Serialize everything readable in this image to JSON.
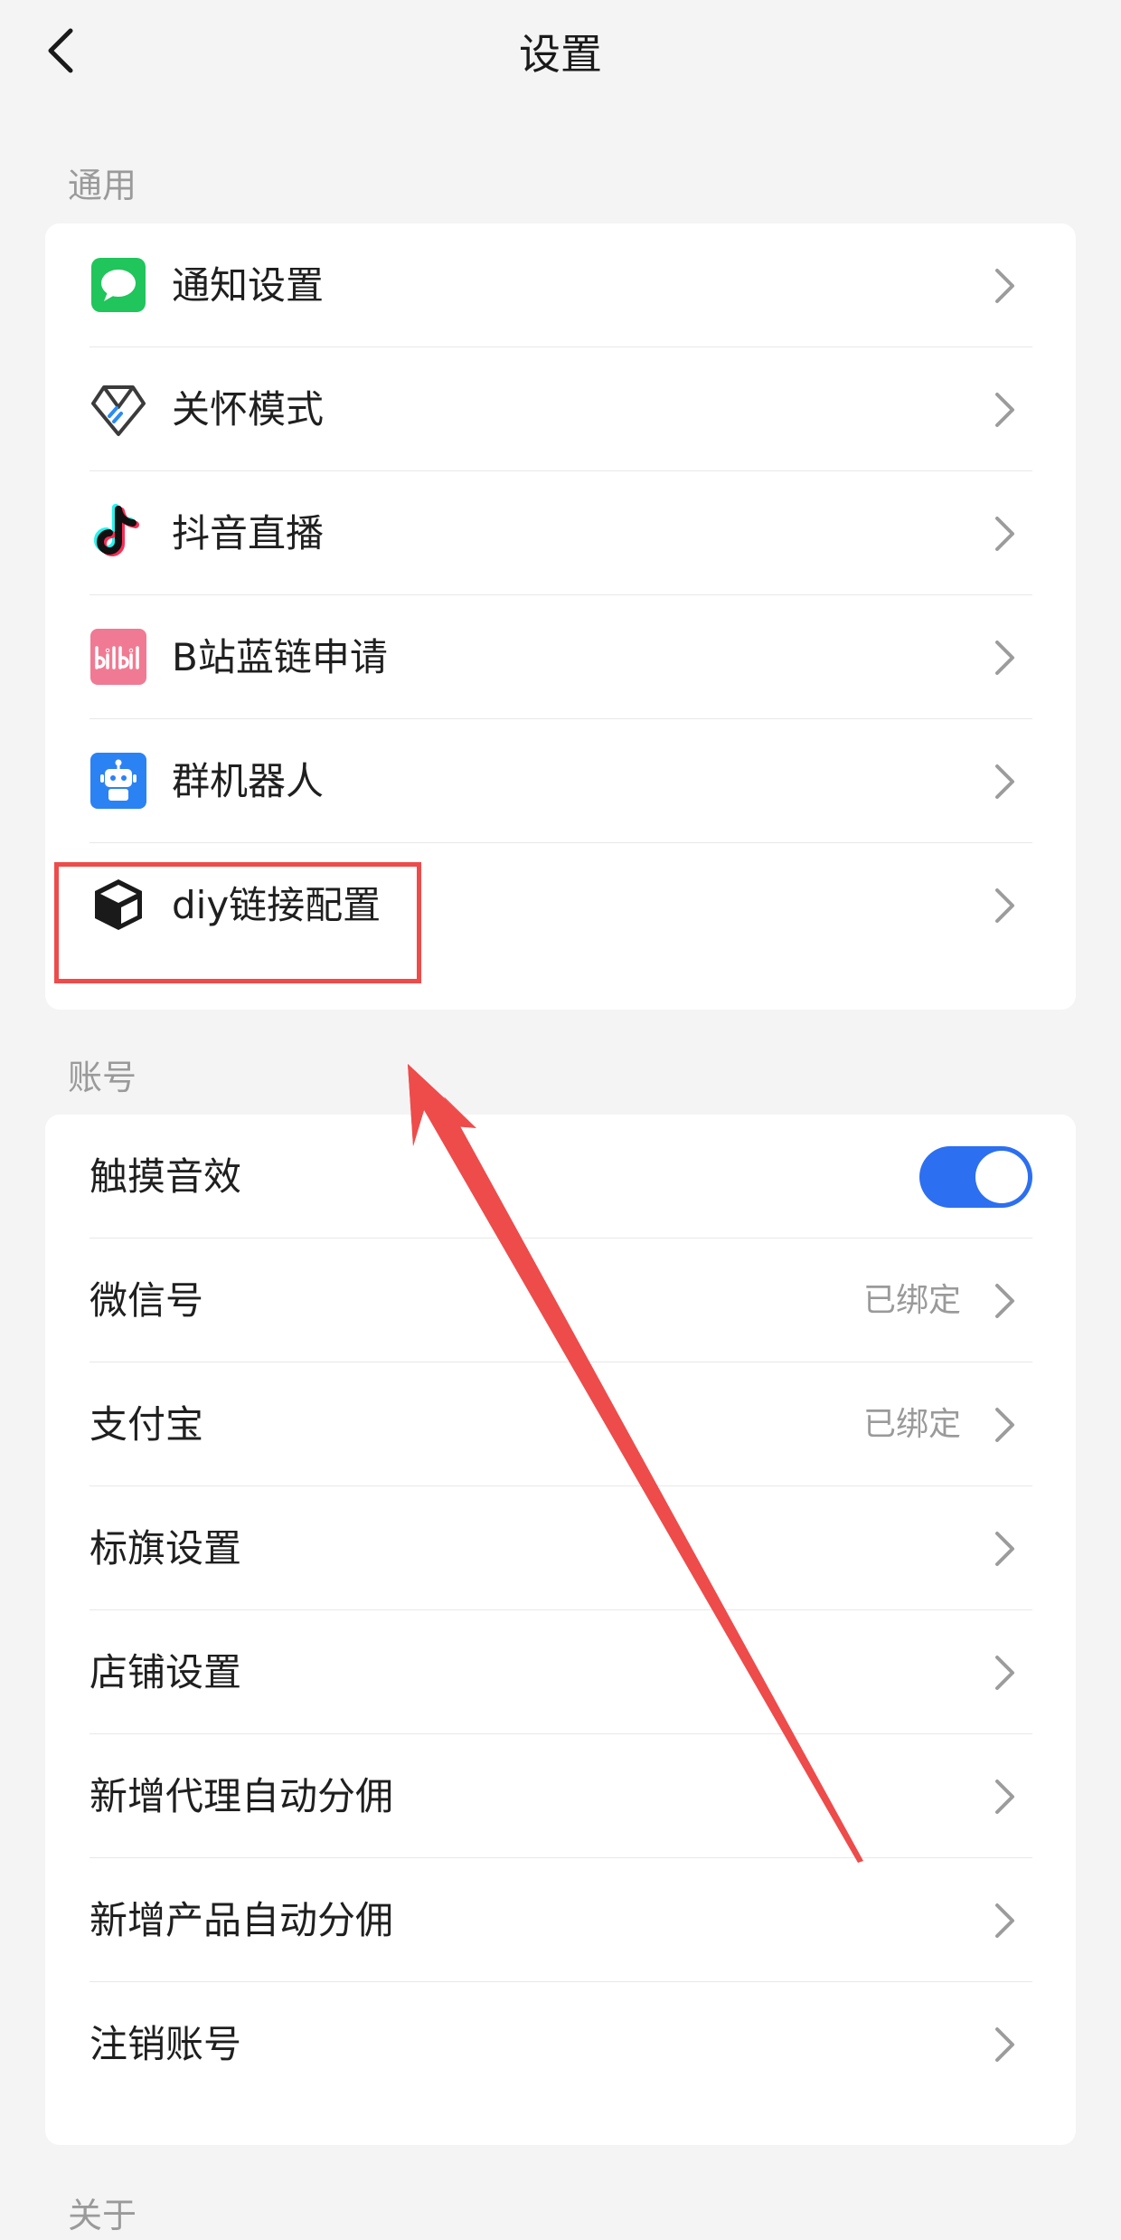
{
  "header": {
    "title": "设置",
    "back_icon": "chevron-left-icon"
  },
  "sections": {
    "general": {
      "title": "通用",
      "items": [
        {
          "label": "通知设置",
          "icon": "message-bubble-icon"
        },
        {
          "label": "关怀模式",
          "icon": "care-heart-icon"
        },
        {
          "label": "抖音直播",
          "icon": "douyin-logo-icon"
        },
        {
          "label": "B站蓝链申请",
          "icon": "bilibili-logo-icon"
        },
        {
          "label": "群机器人",
          "icon": "robot-icon"
        },
        {
          "label": "diy链接配置",
          "icon": "cube-icon"
        }
      ]
    },
    "account": {
      "title": "账号",
      "items": [
        {
          "label": "触摸音效",
          "toggle_on": true
        },
        {
          "label": "微信号",
          "value": "已绑定"
        },
        {
          "label": "支付宝",
          "value": "已绑定"
        },
        {
          "label": "标旗设置"
        },
        {
          "label": "店铺设置"
        },
        {
          "label": "新增代理自动分佣"
        },
        {
          "label": "新增产品自动分佣"
        },
        {
          "label": "注销账号"
        }
      ]
    },
    "about": {
      "title": "关于"
    }
  },
  "colors": {
    "background": "#f4f4f4",
    "toggle_on": "#2c6ff0",
    "annotation_red": "#ee4b4b",
    "secondary_text": "#9a9a9a"
  }
}
